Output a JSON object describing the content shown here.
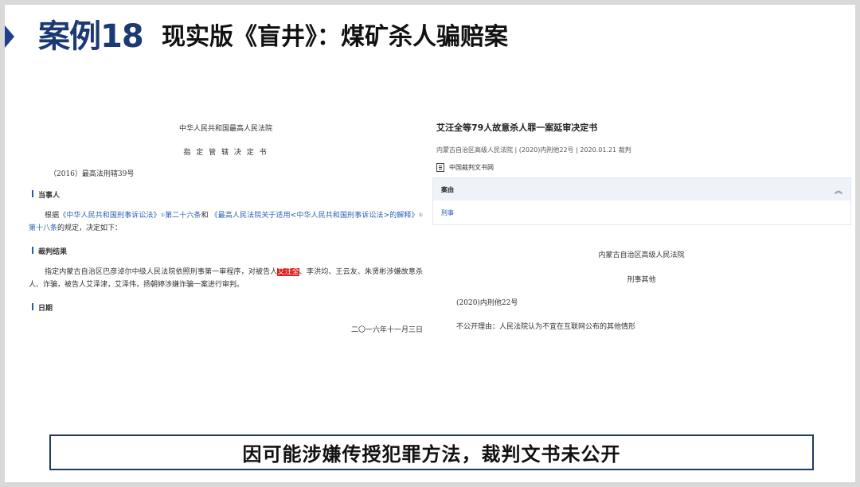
{
  "header": {
    "case_label": "案例18",
    "subtitle": "现实版《盲井》：煤矿杀人骗赔案"
  },
  "left_doc": {
    "court": "中华人民共和国最高人民法院",
    "title": "指 定 管 辖 决 定 书",
    "number": "（2016）最高法刑辖39号",
    "section_parties": "当事人",
    "para1_a": "根据",
    "para1_law1": "《中华人民共和国刑事诉讼法》",
    "para1_sup1": "①",
    "para1_art1": "第二十六条",
    "para1_and": "和",
    "para1_law2": "《最高人民法院关于适用<中华人民共和国刑事诉讼法>的解释》",
    "para1_sup2": "①",
    "para1_art2": "第十八条",
    "para1_tail": "的规定，决定如下：",
    "section_result": "裁判结果",
    "para2_a": "指定内蒙古自治区巴彦淖尔中级人民法院依照刑事第一审程序，对被告人",
    "para2_name": "艾汪全",
    "para2_b": "、李洪均、王云友、朱贤彬涉嫌故意杀人、诈骗，被告人艾泽津，艾泽伟，扬朝婷涉嫌诈骗一案进行审判。",
    "section_date": "日期",
    "date": "二〇一六年十一月三日"
  },
  "right_doc": {
    "title": "艾汪全等79人故意杀人罪一案延审决定书",
    "meta": "内蒙古自治区高级人民法院 |  (2020)内刑他22号  |  2020.01.21 裁判",
    "source": "中国裁判文书网",
    "case_cause_label": "案由",
    "case_cause_value": "刑事",
    "court": "内蒙古自治区高级人民法院",
    "doc_type": "刑事其他",
    "number": "(2020)内刑他22号",
    "reason": "不公开理由：人民法院认为不宜在互联网公布的其他情形"
  },
  "caption": "因可能涉嫌传授犯罪方法，裁判文书未公开",
  "icons": {
    "title_arrow": "chevron-right-icon",
    "source": "document-icon",
    "collapse": "chevron-up-icon"
  },
  "colors": {
    "title_blue": "#1b3a73",
    "link_blue": "#2b62b5",
    "highlight_red": "#e02020",
    "caption_border": "#1e3a5f"
  }
}
